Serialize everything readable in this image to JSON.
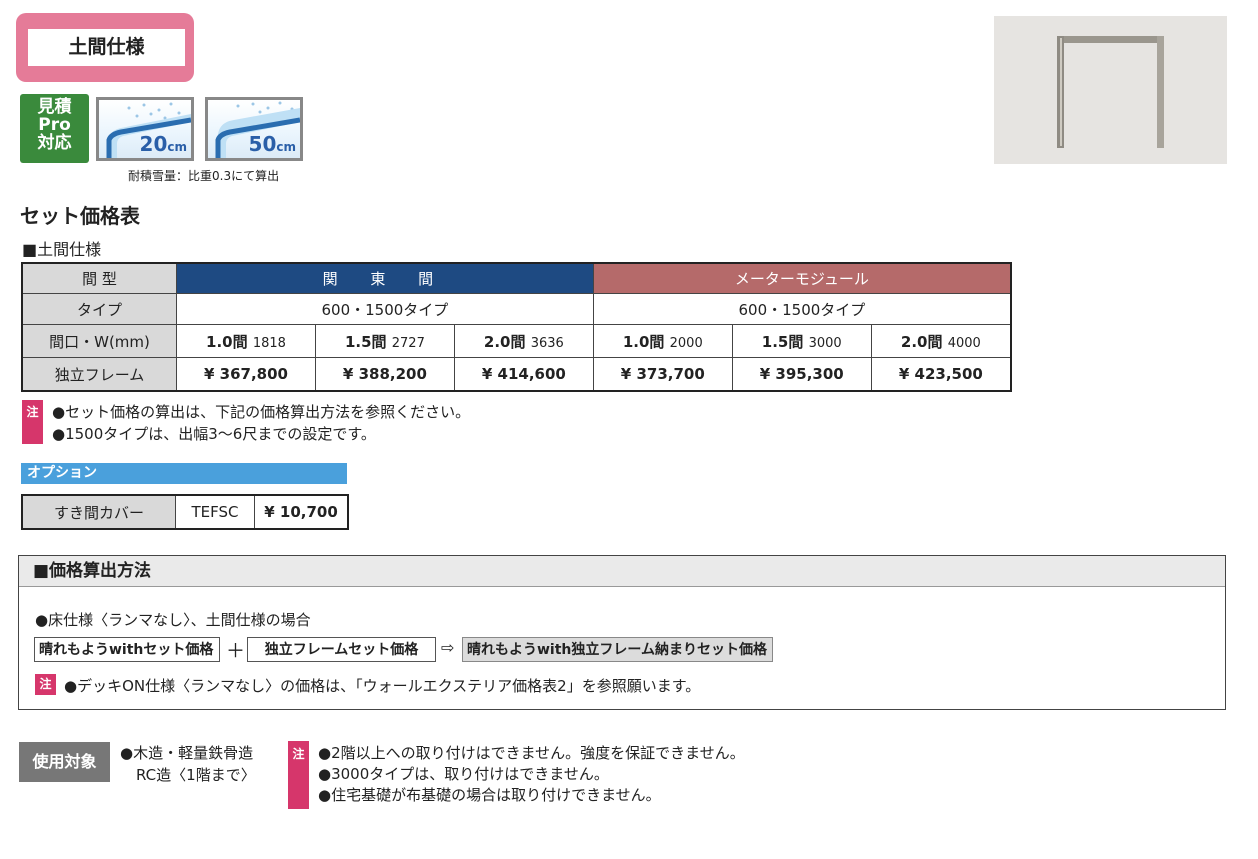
{
  "header": {
    "tag": "土間仕様"
  },
  "badges": {
    "pro": [
      "見積",
      "Pro",
      "対応"
    ],
    "snow": [
      {
        "value": "20",
        "unit": "cm"
      },
      {
        "value": "50",
        "unit": "cm"
      }
    ],
    "snow_note": "耐積雪量：比重0.3にて算出"
  },
  "title": "セット価格表",
  "subtitle": "■土間仕様",
  "table": {
    "labels": [
      "間 型",
      "タイプ",
      "間口・W(mm)",
      "独立フレーム"
    ],
    "groups": [
      "関 東 間",
      "メーターモジュール"
    ],
    "types": [
      "600・1500タイプ",
      "600・1500タイプ"
    ],
    "sizes": [
      {
        "main": "1.0間",
        "sub": "1818"
      },
      {
        "main": "1.5間",
        "sub": "2727"
      },
      {
        "main": "2.0間",
        "sub": "3636"
      },
      {
        "main": "1.0間",
        "sub": "2000"
      },
      {
        "main": "1.5間",
        "sub": "3000"
      },
      {
        "main": "2.0間",
        "sub": "4000"
      }
    ],
    "prices": [
      "¥ 367,800",
      "¥ 388,200",
      "¥ 414,600",
      "¥ 373,700",
      "¥ 395,300",
      "¥ 423,500"
    ]
  },
  "notes": {
    "badge": "注",
    "lines": [
      "●セット価格の算出は、下記の価格算出方法を参照ください。",
      "●1500タイプは、出幅3～6尺までの設定です。"
    ]
  },
  "option": {
    "heading": "オプション",
    "name": "すき間カバー",
    "code": "TEFSC",
    "price": "¥ 10,700"
  },
  "calc": {
    "heading": "■価格算出方法",
    "sub": "●床仕様〈ランマなし〉、土間仕様の場合",
    "box1": "晴れもようwithセット価格",
    "plus": "＋",
    "box2": "独立フレームセット価格",
    "arrow": "⇨",
    "box3": "晴れもようwith独立フレーム納まりセット価格",
    "note_badge": "注",
    "note": "●デッキON仕様〈ランマなし〉の価格は、「ウォールエクステリア価格表2」を参照願います。"
  },
  "usage": {
    "label": "使用対象",
    "lines": [
      "●木造・軽量鉄骨造",
      "RC造〈1階まで〉"
    ],
    "note_badge": "注",
    "notes": [
      "●2階以上への取り付けはできません。強度を保証できません。",
      "●3000タイプは、取り付けはできません。",
      "●住宅基礎が布基礎の場合は取り付けできません。"
    ]
  }
}
